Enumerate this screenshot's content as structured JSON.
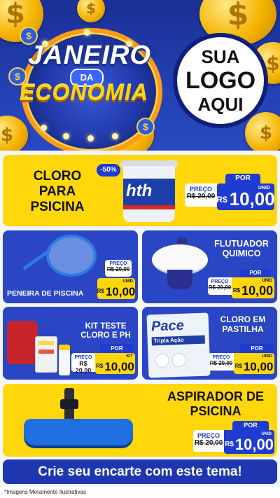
{
  "hero": {
    "line1": "JANEIRO",
    "line2": "DA",
    "line3": "ECONOMIA",
    "logo": [
      "SUA",
      "LOGO",
      "AQUI"
    ]
  },
  "products": [
    {
      "name": "CLORO PARA PSICINA",
      "discount": "-50%",
      "preco_label": "PREÇO",
      "old_price": "R$ 20,00",
      "por_label": "POR",
      "currency": "R$",
      "price": "10,00",
      "unit": "UNID",
      "pack_brand": "hth"
    },
    {
      "name": "PENEIRA DE PISCINA",
      "preco_label": "PREÇO",
      "old_price": "R$ 20,00",
      "por_label": "POR",
      "currency": "R$",
      "price": "10,00",
      "unit": "UNID"
    },
    {
      "name": "FLUTUADOR QUIMICO",
      "preco_label": "PREÇO",
      "old_price": "R$ 20,00",
      "por_label": "POR",
      "currency": "R$",
      "price": "10,00",
      "unit": "UNID"
    },
    {
      "name": "KIT TESTE CLORO E PH",
      "preco_label": "PREÇO",
      "old_price": "R$ 20,00",
      "por_label": "POR",
      "currency": "R$",
      "price": "10,00",
      "unit": "KIT"
    },
    {
      "name": "CLORO EM PASTILHA",
      "preco_label": "PREÇO",
      "old_price": "R$ 20,00",
      "por_label": "POR",
      "currency": "R$",
      "price": "10,00",
      "unit": "UNID",
      "pack_brand": "Pace",
      "pack_line": "Tripla Ação"
    },
    {
      "name": "ASPIRADOR DE PSICINA",
      "preco_label": "PREÇO",
      "old_price": "R$ 20,00",
      "por_label": "POR",
      "currency": "R$",
      "price": "10,00",
      "unit": "UNID"
    }
  ],
  "cta": "Crie seu encarte com este tema!",
  "footnote": "*Imagens Meramente Ilustrativas",
  "colors": {
    "yellow": "#ffd70a",
    "blue": "#2b46c5",
    "price_blue": "#1e3bd2"
  }
}
